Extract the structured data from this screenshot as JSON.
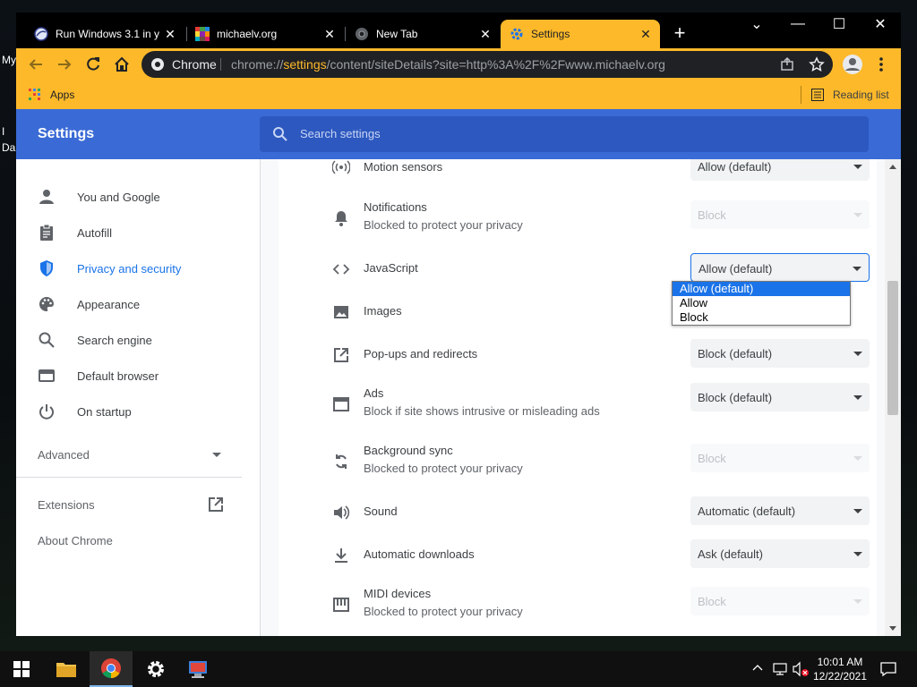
{
  "desktop": {
    "labels": [
      "My",
      "I",
      "Da"
    ]
  },
  "tabs": [
    {
      "title": "Run Windows 3.1 in y",
      "close": "✕"
    },
    {
      "title": "michaelv.org",
      "close": "✕"
    },
    {
      "title": "New Tab",
      "close": "✕"
    },
    {
      "title": "Settings",
      "close": "✕",
      "active": true
    }
  ],
  "newtab_label": "+",
  "window_controls": {
    "dropdown": "⌄",
    "minimize": "—",
    "maximize": "☐",
    "close": "✕"
  },
  "omnibox": {
    "site": "Chrome",
    "scheme": "chrome://",
    "host": "settings",
    "path": "/content/siteDetails?site=http%3A%2F%2Fwww.michaelv.org"
  },
  "bookmarks": {
    "apps": "Apps",
    "reading_list": "Reading list"
  },
  "settings": {
    "title": "Settings",
    "search_placeholder": "Search settings"
  },
  "sidebar": {
    "items": [
      {
        "label": "You and Google",
        "icon": "person-icon"
      },
      {
        "label": "Autofill",
        "icon": "clipboard-icon"
      },
      {
        "label": "Privacy and security",
        "icon": "shield-icon",
        "selected": true
      },
      {
        "label": "Appearance",
        "icon": "palette-icon"
      },
      {
        "label": "Search engine",
        "icon": "search-icon"
      },
      {
        "label": "Default browser",
        "icon": "browser-icon"
      },
      {
        "label": "On startup",
        "icon": "power-icon"
      }
    ],
    "advanced": "Advanced",
    "extensions": "Extensions",
    "about": "About Chrome"
  },
  "permissions": [
    {
      "name": "Motion sensors",
      "sub": "",
      "value": "Allow (default)",
      "disabled": false,
      "icon": "motion-sensor-icon"
    },
    {
      "name": "Notifications",
      "sub": "Blocked to protect your privacy",
      "value": "Block",
      "disabled": true,
      "icon": "bell-icon"
    },
    {
      "name": "JavaScript",
      "sub": "",
      "value": "Allow (default)",
      "disabled": false,
      "focused": true,
      "icon": "code-icon"
    },
    {
      "name": "Images",
      "sub": "",
      "value": "",
      "disabled": false,
      "icon": "image-icon"
    },
    {
      "name": "Pop-ups and redirects",
      "sub": "",
      "value": "Block (default)",
      "disabled": false,
      "icon": "popup-icon"
    },
    {
      "name": "Ads",
      "sub": "Block if site shows intrusive or misleading ads",
      "value": "Block (default)",
      "disabled": false,
      "icon": "ads-icon"
    },
    {
      "name": "Background sync",
      "sub": "Blocked to protect your privacy",
      "value": "Block",
      "disabled": true,
      "icon": "sync-icon"
    },
    {
      "name": "Sound",
      "sub": "",
      "value": "Automatic (default)",
      "disabled": false,
      "icon": "speaker-icon"
    },
    {
      "name": "Automatic downloads",
      "sub": "",
      "value": "Ask (default)",
      "disabled": false,
      "icon": "download-icon"
    },
    {
      "name": "MIDI devices",
      "sub": "Blocked to protect your privacy",
      "value": "Block",
      "disabled": true,
      "icon": "piano-icon"
    }
  ],
  "javascript_dropdown": {
    "options": [
      "Allow (default)",
      "Allow",
      "Block"
    ],
    "highlighted": "Allow (default)"
  },
  "taskbar": {
    "time": "10:01 AM",
    "date": "12/22/2021"
  },
  "colors": {
    "accent": "#fdb92a",
    "header": "#3a6ad5",
    "link": "#1a73e8"
  }
}
